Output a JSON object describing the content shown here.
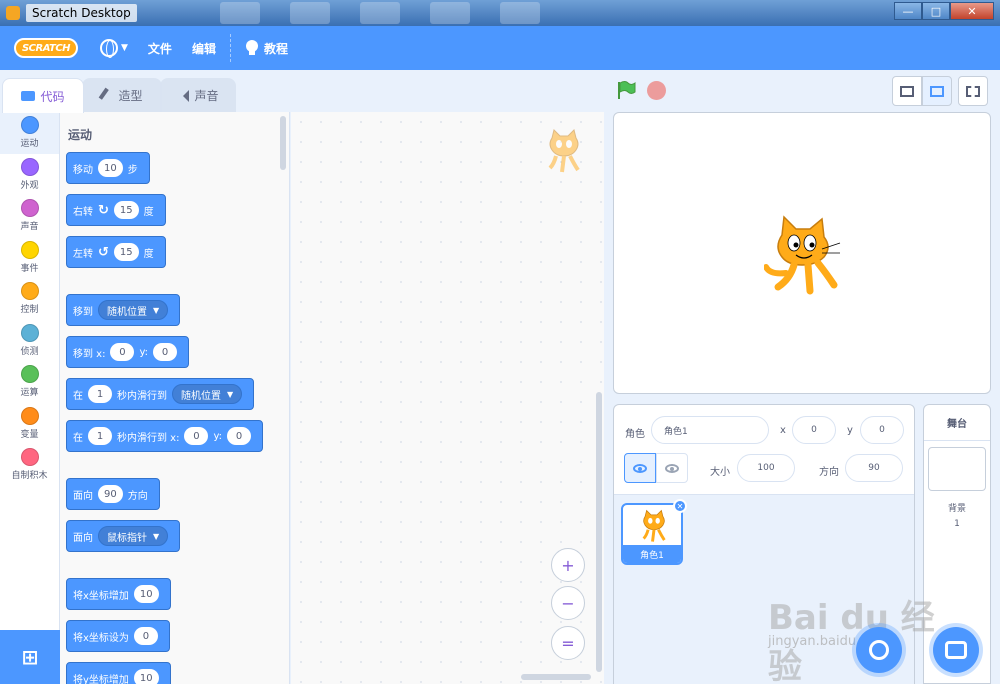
{
  "window": {
    "title": "Scratch Desktop",
    "controls": [
      "minimize-icon",
      "maximize-icon",
      "close-icon"
    ]
  },
  "menubar": {
    "logo": "SCRATCH",
    "language_icon": "globe-icon",
    "file": "文件",
    "edit": "编辑",
    "tutorials": "教程",
    "tutorials_icon": "lightbulb-icon"
  },
  "tabs": [
    {
      "label": "代码",
      "icon": "code-icon",
      "active": true
    },
    {
      "label": "造型",
      "icon": "brush-icon",
      "active": false
    },
    {
      "label": "声音",
      "icon": "speaker-icon",
      "active": false
    }
  ],
  "categories": [
    {
      "label": "运动",
      "color": "#4c97ff"
    },
    {
      "label": "外观",
      "color": "#9966ff"
    },
    {
      "label": "声音",
      "color": "#cf63cf"
    },
    {
      "label": "事件",
      "color": "#ffd500"
    },
    {
      "label": "控制",
      "color": "#ffab19"
    },
    {
      "label": "侦测",
      "color": "#5cb1d6"
    },
    {
      "label": "运算",
      "color": "#59c059"
    },
    {
      "label": "变量",
      "color": "#ff8c1a"
    },
    {
      "label": "自制积木",
      "color": "#ff6680"
    }
  ],
  "palette": {
    "heading": "运动",
    "blocks": {
      "move": {
        "pre": "移动",
        "value": "10",
        "post": "步"
      },
      "turn_right": {
        "pre": "右转",
        "value": "15",
        "post": "度"
      },
      "turn_left": {
        "pre": "左转",
        "value": "15",
        "post": "度"
      },
      "goto": {
        "pre": "移到",
        "option": "随机位置"
      },
      "goto_xy": {
        "pre": "移到 x:",
        "x": "0",
        "mid": "y:",
        "y": "0"
      },
      "glide": {
        "pre": "在",
        "value": "1",
        "mid": "秒内滑行到",
        "option": "随机位置"
      },
      "glide_xy": {
        "pre": "在",
        "value": "1",
        "mid": "秒内滑行到 x:",
        "x": "0",
        "mid2": "y:",
        "y": "0"
      },
      "point_dir": {
        "pre": "面向",
        "value": "90",
        "post": "方向"
      },
      "point_towards": {
        "pre": "面向",
        "option": "鼠标指针"
      },
      "change_x": {
        "pre": "将x坐标增加",
        "value": "10"
      },
      "set_x": {
        "pre": "将x坐标设为",
        "value": "0"
      },
      "change_y": {
        "pre": "将y坐标增加",
        "value": "10"
      }
    }
  },
  "zoom": {
    "in": "+",
    "out": "−",
    "reset": "="
  },
  "sprite_info": {
    "sprite_label": "角色",
    "sprite_name": "角色1",
    "x_label": "x",
    "x_value": "0",
    "y_label": "y",
    "y_value": "0",
    "size_label": "大小",
    "size_value": "100",
    "direction_label": "方向",
    "direction_value": "90"
  },
  "sprites": [
    {
      "name": "角色1",
      "selected": true
    }
  ],
  "stage_pane": {
    "title": "舞台",
    "backdrops_label": "背景",
    "backdrops_count": "1"
  },
  "watermark": {
    "text": "Bai du 经验",
    "sub": "jingyan.baidu.com"
  },
  "colors": {
    "accent": "#4c97ff",
    "motion": "#4c97ff",
    "menu": "#4c97ff"
  }
}
